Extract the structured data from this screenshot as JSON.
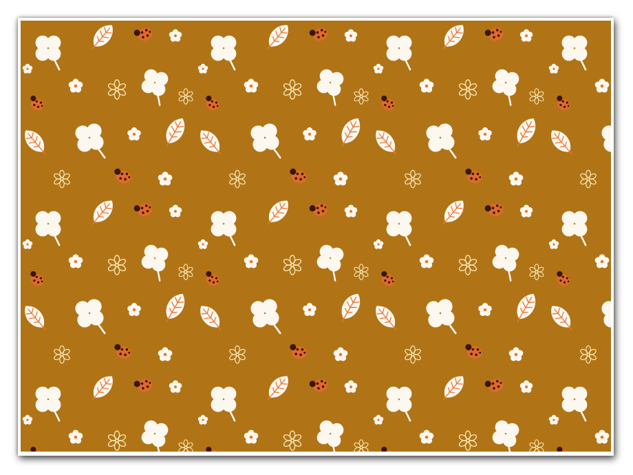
{
  "image": {
    "subject": "",
    "colors": {
      "background": "#b07416",
      "frame": "#ffffff",
      "motif_white": "#fdf8ef",
      "ladybug": "#df6a2b",
      "ladybug_spots": "#3a1608",
      "leaf_vein": "#e8763a",
      "outline_flower": "#f6e3b0"
    },
    "motifs": [
      "four-leaf-clover",
      "leaf",
      "ladybug",
      "five-petal-flower",
      "outline-daisy"
    ]
  }
}
